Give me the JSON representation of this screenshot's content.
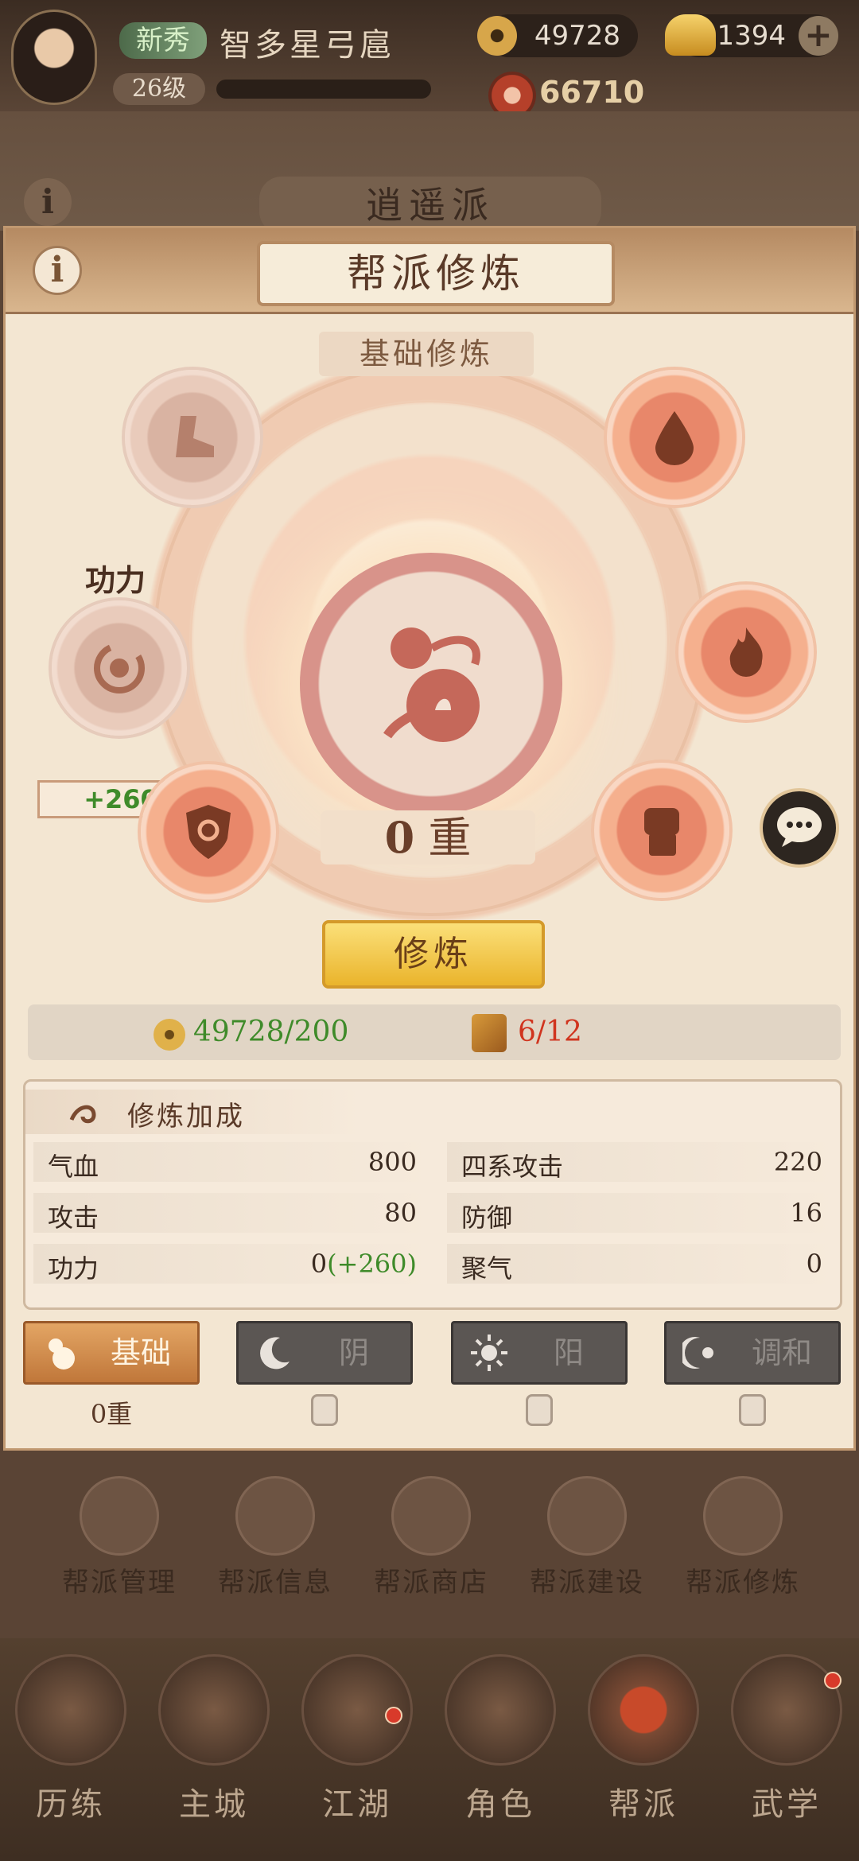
{
  "header": {
    "rank_badge": "新秀",
    "player_name": "智多星弓扈",
    "level": "26级",
    "coins": "49728",
    "ingots": "11394",
    "power": "66710"
  },
  "guild": {
    "name": "逍遥派",
    "info_icon": "i"
  },
  "panel": {
    "info_icon": "i",
    "title": "帮派修炼",
    "subtitle": "基础修炼",
    "gong_label": "功力",
    "gong_bonus": "+260",
    "level_num": "0",
    "level_unit": "重",
    "train_button": "修炼",
    "cost_coins": "49728/200",
    "cost_items": "6/12"
  },
  "stats": {
    "title": "修炼加成",
    "rows": [
      {
        "k1": "气血",
        "v1": "800",
        "k2": "四系攻击",
        "v2": "220"
      },
      {
        "k1": "攻击",
        "v1": "80",
        "k2": "防御",
        "v2": "16"
      },
      {
        "k1": "功力",
        "v1": "0",
        "v1_bonus": "(+260)",
        "k2": "聚气",
        "v2": "0"
      }
    ]
  },
  "tabs": [
    {
      "label": "基础",
      "status": "0重"
    },
    {
      "label": "阴"
    },
    {
      "label": "阳"
    },
    {
      "label": "调和"
    }
  ],
  "guild_menu": [
    "帮派管理",
    "帮派信息",
    "帮派商店",
    "帮派建设",
    "帮派修炼"
  ],
  "bottom_nav": [
    "历练",
    "主城",
    "江湖",
    "角色",
    "帮派",
    "武学"
  ],
  "colors": {
    "accent_green": "#3f8b2a",
    "accent_red": "#d0341e",
    "button_gold": "#eab42c"
  },
  "icons": {
    "nodes": [
      "boot-icon",
      "water-drop-icon",
      "spiral-icon",
      "flame-icon",
      "shield-icon",
      "fist-icon"
    ],
    "center": "gourd-icon"
  }
}
